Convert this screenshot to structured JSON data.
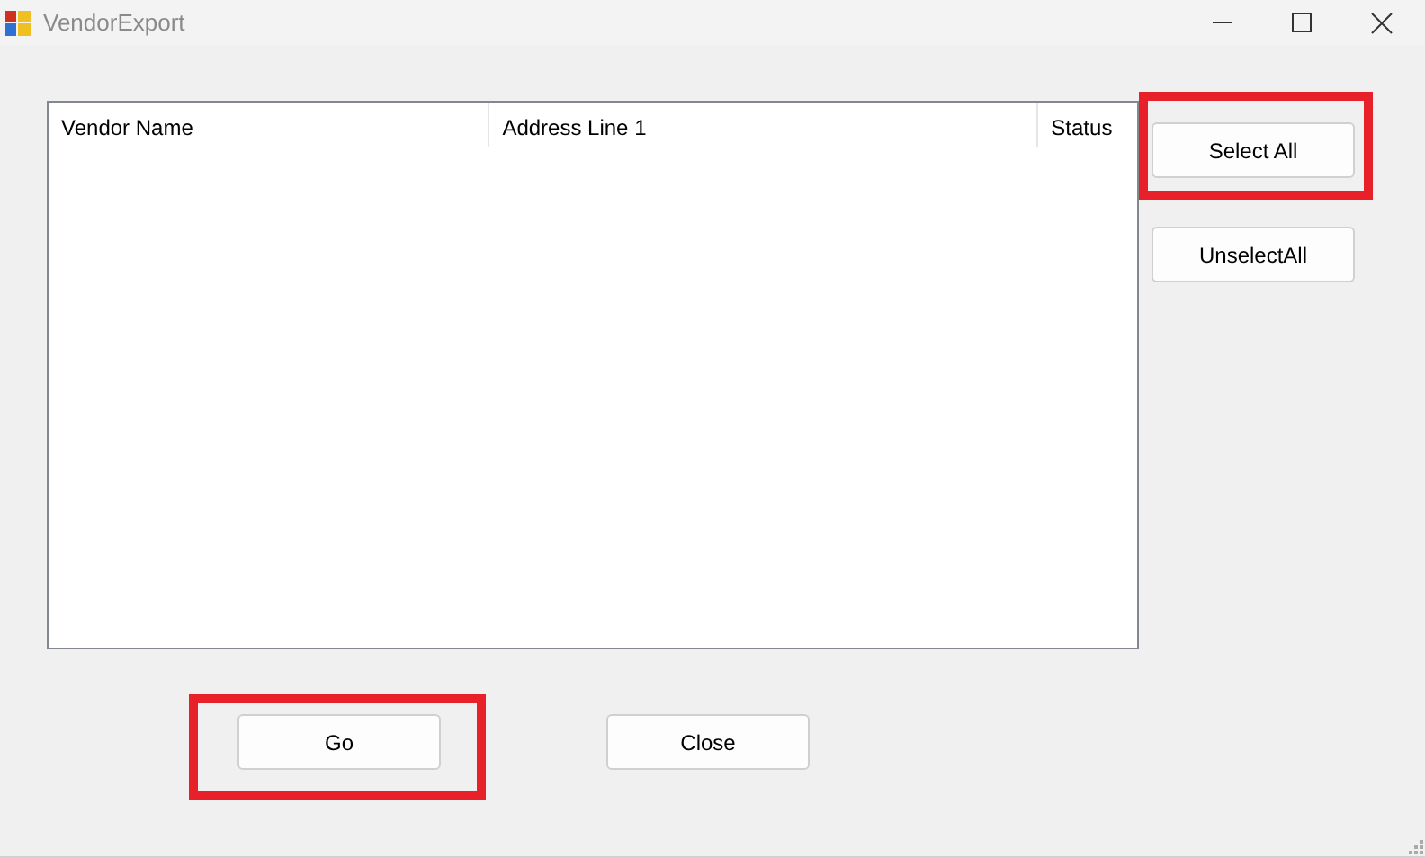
{
  "window": {
    "title": "VendorExport"
  },
  "list": {
    "columns": [
      {
        "label": "Vendor Name"
      },
      {
        "label": "Address Line 1"
      },
      {
        "label": "Status"
      }
    ]
  },
  "side_buttons": [
    {
      "label": "Select All",
      "highlighted": true
    },
    {
      "label": "UnselectAll",
      "highlighted": false
    }
  ],
  "bottom_buttons": [
    {
      "label": "Go",
      "highlighted": true
    },
    {
      "label": "Close",
      "highlighted": false
    }
  ]
}
